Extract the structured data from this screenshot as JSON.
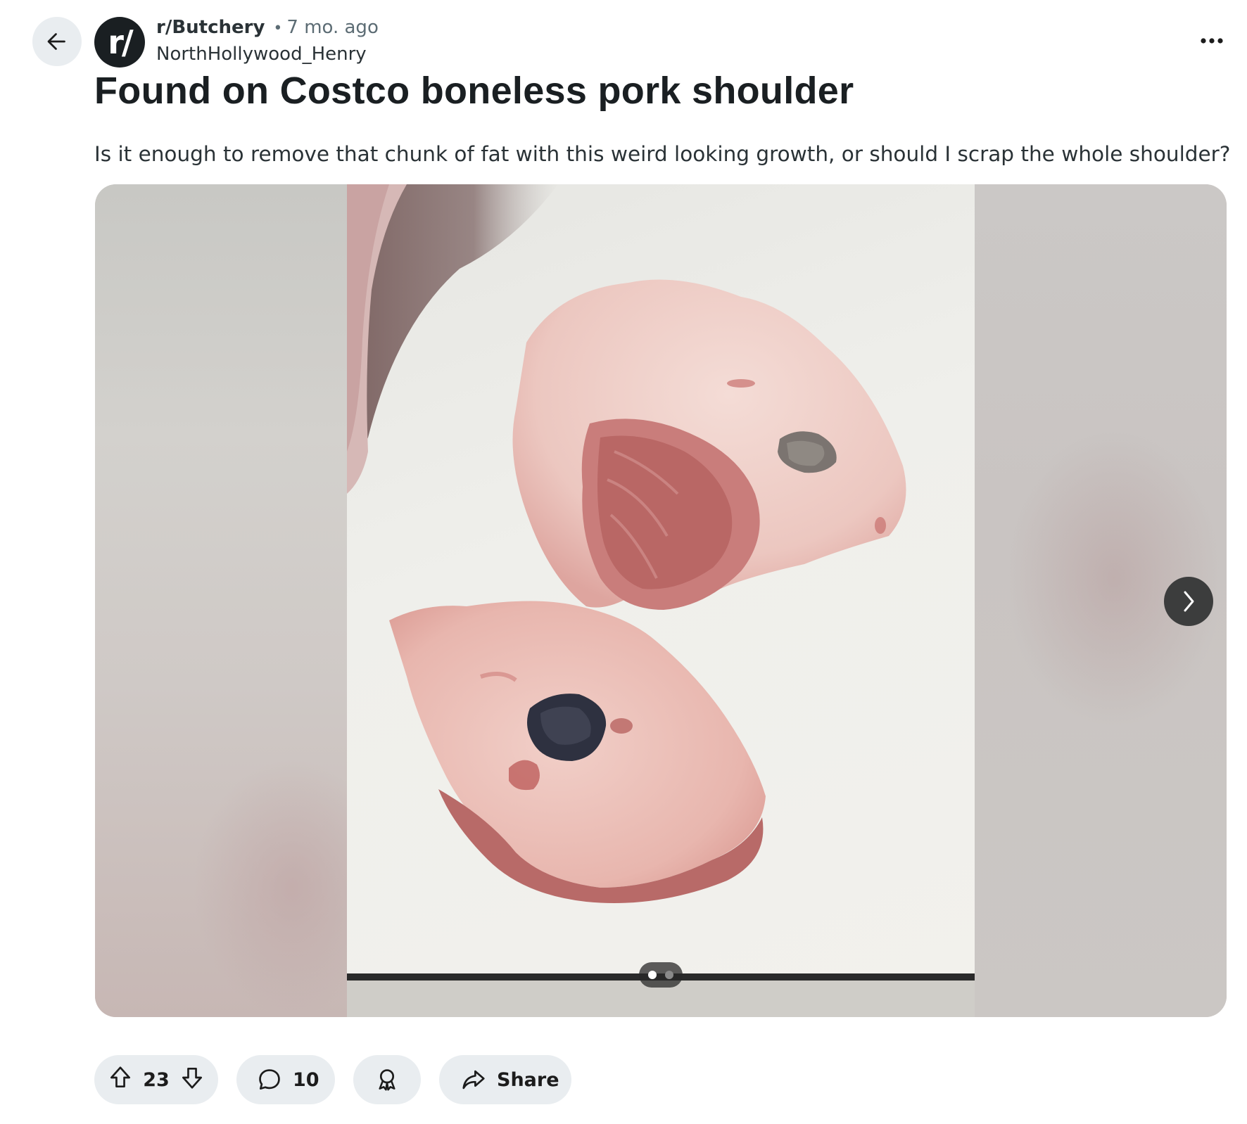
{
  "header": {
    "subreddit": "r/Butchery",
    "separator": "•",
    "age": "7 mo. ago",
    "author": "NorthHollywood_Henry",
    "avatar_text": "r/"
  },
  "post": {
    "title": "Found on Costco boneless pork shoulder",
    "body": "Is it enough to remove that chunk of fat with this weird looking growth, or should I scrap the whole shoulder?"
  },
  "gallery": {
    "current_index": 1,
    "total": 2
  },
  "actions": {
    "score": "23",
    "comments": "10",
    "share_label": "Share"
  },
  "icons": {
    "back": "arrow-left-icon",
    "more": "more-horizontal-icon",
    "next": "chevron-right-icon",
    "upvote": "upvote-icon",
    "downvote": "downvote-icon",
    "comment": "comment-icon",
    "award": "award-icon",
    "share": "share-icon"
  }
}
